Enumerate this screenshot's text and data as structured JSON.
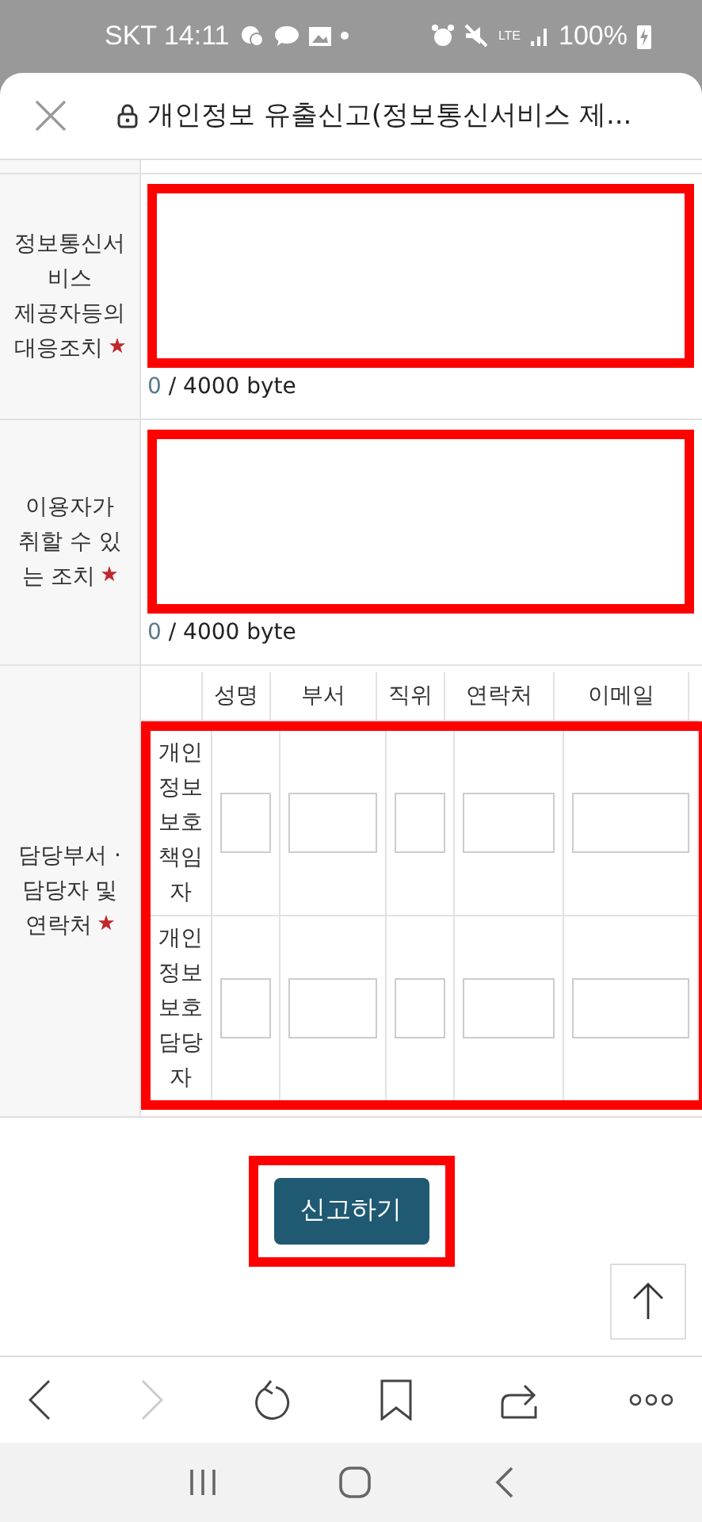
{
  "status_bar": {
    "carrier_time": "SKT 14:11",
    "network": "LTE",
    "battery": "100%"
  },
  "header": {
    "title": "개인정보 유출신고(정보통신서비스 제..."
  },
  "form": {
    "rows": [
      {
        "kind": "textarea",
        "label_lines": [
          "정보통신서",
          "비스",
          "제공자등의",
          "대응조치"
        ],
        "required": true,
        "highlighted": true,
        "count": "0",
        "limit": "/ 4000 byte"
      },
      {
        "kind": "textarea",
        "label_lines": [
          "이용자가",
          "취할 수 있",
          "는 조치"
        ],
        "required": true,
        "highlighted": true,
        "count": "0",
        "limit": "/ 4000 byte"
      },
      {
        "kind": "contacts",
        "label_lines": [
          "담당부서 ·",
          "담당자 및",
          "연락처"
        ],
        "required": true,
        "highlighted": true,
        "columns": [
          "성명",
          "부서",
          "직위",
          "연락처",
          "이메일"
        ],
        "people": [
          "개인정보보호책임자",
          "개인정보보호담당자"
        ]
      }
    ]
  },
  "submit": {
    "label": "신고하기",
    "highlighted": true
  }
}
